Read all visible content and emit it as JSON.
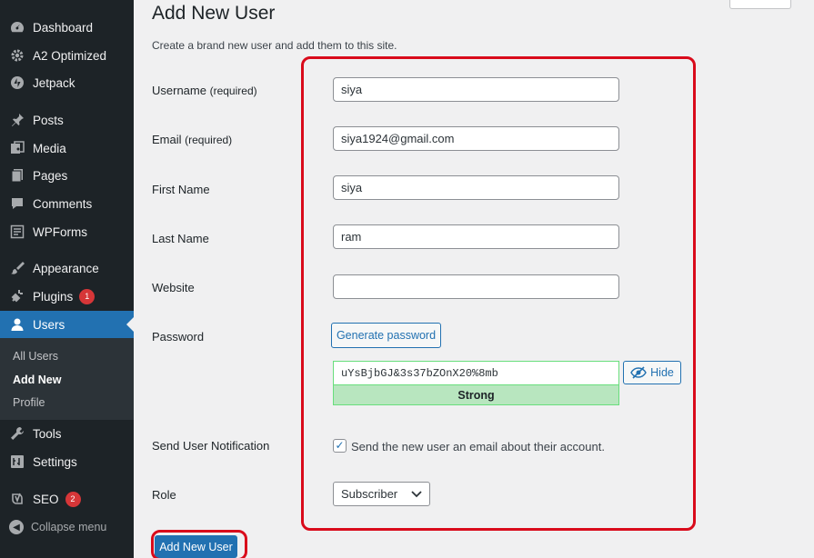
{
  "sidebar": {
    "items": [
      {
        "label": "Dashboard",
        "icon": "dashboard-icon"
      },
      {
        "label": "A2 Optimized",
        "icon": "gear-icon"
      },
      {
        "label": "Jetpack",
        "icon": "jetpack-icon"
      },
      {
        "label": "Posts",
        "icon": "pin-icon"
      },
      {
        "label": "Media",
        "icon": "media-icon"
      },
      {
        "label": "Pages",
        "icon": "pages-icon"
      },
      {
        "label": "Comments",
        "icon": "comment-icon"
      },
      {
        "label": "WPForms",
        "icon": "forms-icon"
      },
      {
        "label": "Appearance",
        "icon": "brush-icon"
      },
      {
        "label": "Plugins",
        "icon": "plugin-icon",
        "badge": "1"
      },
      {
        "label": "Users",
        "icon": "user-icon",
        "active": true
      },
      {
        "label": "Tools",
        "icon": "wrench-icon"
      },
      {
        "label": "Settings",
        "icon": "settings-icon"
      },
      {
        "label": "SEO",
        "icon": "yoast-icon",
        "badge": "2"
      }
    ],
    "submenu": [
      {
        "label": "All Users"
      },
      {
        "label": "Add New",
        "current": true
      },
      {
        "label": "Profile"
      }
    ],
    "collapse_label": "Collapse menu"
  },
  "page": {
    "title": "Add New User",
    "description": "Create a brand new user and add them to this site."
  },
  "form": {
    "username": {
      "label": "Username",
      "note": "(required)",
      "value": "siya"
    },
    "email": {
      "label": "Email",
      "note": "(required)",
      "value": "siya1924@gmail.com"
    },
    "first_name": {
      "label": "First Name",
      "value": "siya"
    },
    "last_name": {
      "label": "Last Name",
      "value": "ram"
    },
    "website": {
      "label": "Website",
      "value": ""
    },
    "password": {
      "label": "Password",
      "generate_label": "Generate password",
      "value": "uYsBjbGJ&3s37bZOnX20%8mb",
      "hide_label": "Hide",
      "strength": "Strong"
    },
    "notification": {
      "label": "Send User Notification",
      "checkbox_label": "Send the new user an email about their account.",
      "checked": true
    },
    "role": {
      "label": "Role",
      "value": "Subscriber"
    },
    "submit_label": "Add New User"
  },
  "colors": {
    "sidebar_bg": "#1d2327",
    "accent": "#2271b1",
    "highlight": "#d90b1b",
    "strength_bg": "#b8e6bf"
  }
}
